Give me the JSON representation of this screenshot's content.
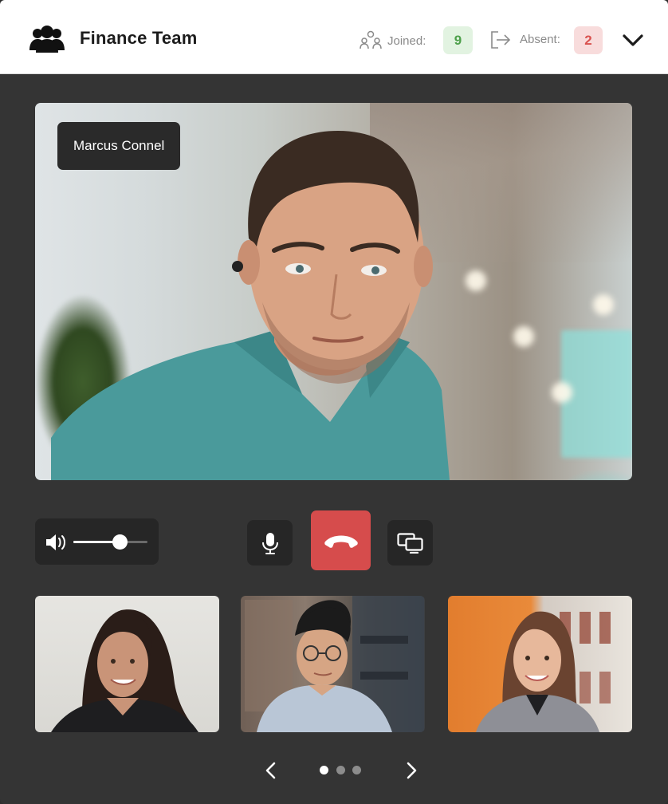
{
  "header": {
    "team_name": "Finance Team",
    "team_icon": "users-group-icon",
    "joined": {
      "label": "Joined:",
      "count": "9",
      "icon": "participants-icon"
    },
    "absent": {
      "label": "Absent:",
      "count": "2",
      "icon": "exit-icon"
    },
    "expand_icon": "chevron-down-icon"
  },
  "main_video": {
    "speaker_name": "Marcus Connel"
  },
  "controls": {
    "volume_icon": "speaker-icon",
    "volume_level": 0.62,
    "mic_icon": "microphone-icon",
    "hangup_icon": "phone-hangup-icon",
    "screen_share_icon": "screen-share-icon"
  },
  "participants": [
    {
      "name": "",
      "thumbnail": "woman-dark-hair"
    },
    {
      "name": "",
      "thumbnail": "man-glasses"
    },
    {
      "name": "",
      "thumbnail": "woman-blazer"
    }
  ],
  "pager": {
    "prev_icon": "chevron-left-icon",
    "next_icon": "chevron-right-icon",
    "pages": 3,
    "current": 1
  },
  "colors": {
    "background": "#343434",
    "header": "#ffffff",
    "joined_badge_bg": "#e2f3e1",
    "joined_badge_text": "#4ea04b",
    "absent_badge_bg": "#f8dcdc",
    "absent_badge_text": "#d9524f",
    "hangup": "#d64c4c",
    "control_bg": "#262626"
  }
}
